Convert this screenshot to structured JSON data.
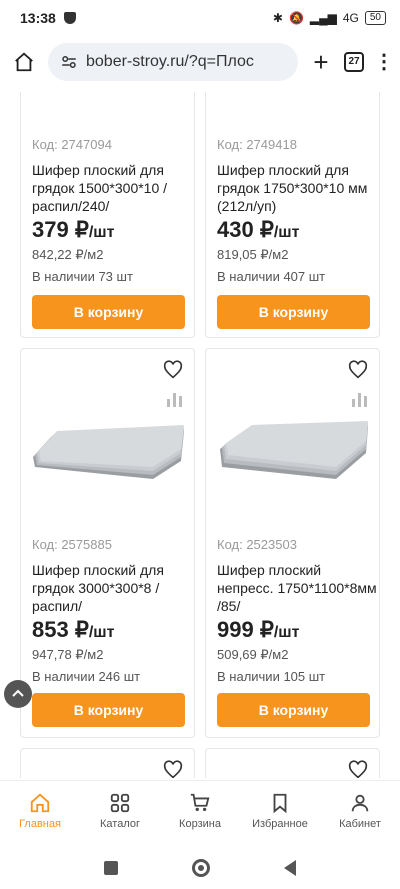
{
  "status_bar": {
    "time": "13:38",
    "battery": "50",
    "network": "4G"
  },
  "browser": {
    "url": "bober-stroy.ru/?q=Плос",
    "tab_count": "27"
  },
  "products": [
    {
      "code": "Код: 2747094",
      "title": "Шифер плоский для грядок 1500*300*10 / распил/240/",
      "price": "379 ₽",
      "unit": "/шт",
      "price_per_m2": "842,22 ₽/м2",
      "stock": "В наличии 73 шт",
      "button": "В корзину"
    },
    {
      "code": "Код: 2749418",
      "title": "Шифер плоский для грядок 1750*300*10 мм (212л/уп)",
      "price": "430 ₽",
      "unit": "/шт",
      "price_per_m2": "819,05 ₽/м2",
      "stock": "В наличии 407 шт",
      "button": "В корзину"
    },
    {
      "code": "Код: 2575885",
      "title": "Шифер плоский для грядок 3000*300*8 / распил/",
      "price": "853 ₽",
      "unit": "/шт",
      "price_per_m2": "947,78 ₽/м2",
      "stock": "В наличии 246 шт",
      "button": "В корзину"
    },
    {
      "code": "Код: 2523503",
      "title": "Шифер плоский непресс. 1750*1100*8мм /85/",
      "price": "999 ₽",
      "unit": "/шт",
      "price_per_m2": "509,69 ₽/м2",
      "stock": "В наличии 105 шт",
      "button": "В корзину"
    }
  ],
  "bottom_nav": [
    {
      "label": "Главная",
      "icon": "home-icon",
      "active": true
    },
    {
      "label": "Каталог",
      "icon": "grid-icon",
      "active": false
    },
    {
      "label": "Корзина",
      "icon": "cart-icon",
      "active": false
    },
    {
      "label": "Избранное",
      "icon": "bookmark-icon",
      "active": false
    },
    {
      "label": "Кабинет",
      "icon": "user-icon",
      "active": false
    }
  ],
  "colors": {
    "accent": "#f7941d"
  }
}
